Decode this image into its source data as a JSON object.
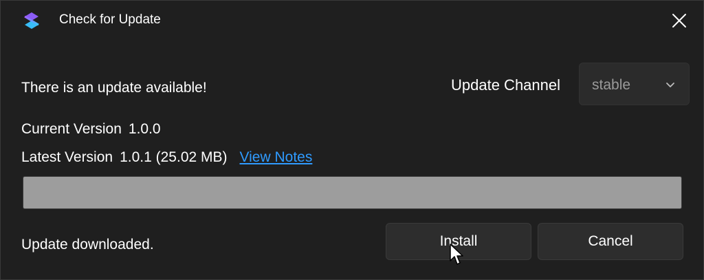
{
  "window": {
    "title": "Check for Update",
    "app_icon": "app-logo-icon",
    "close_icon": "close-icon"
  },
  "update": {
    "headline": "There is an update available!",
    "channel_label": "Update Channel",
    "channel_value": "stable",
    "current_label": "Current Version",
    "current_version": "1.0.0",
    "latest_label": "Latest Version",
    "latest_version": "1.0.1 (25.02 MB)",
    "view_notes": "View Notes",
    "progress_percent": 100,
    "status": "Update downloaded."
  },
  "buttons": {
    "install": "Install",
    "cancel": "Cancel"
  },
  "colors": {
    "background": "#1f1f1f",
    "link": "#2f9bff",
    "progress_fill": "#9d9d9d"
  }
}
